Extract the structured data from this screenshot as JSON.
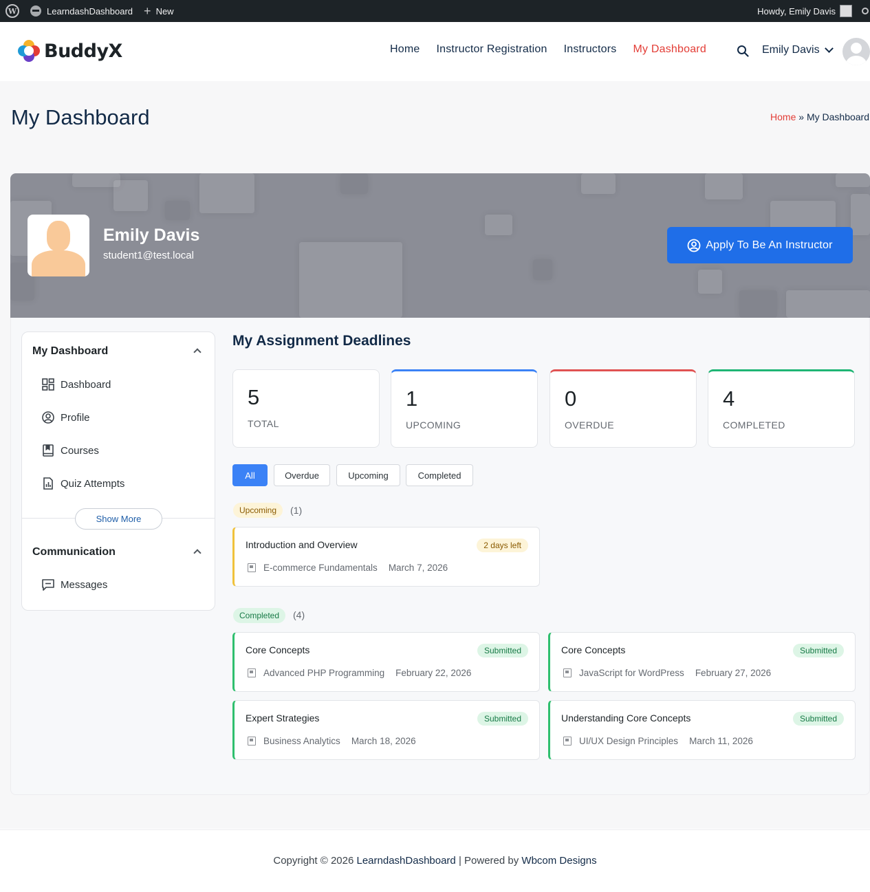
{
  "adminbar": {
    "site_name": "LearndashDashboard",
    "new_label": "New",
    "howdy": "Howdy, Emily Davis"
  },
  "header": {
    "logo_text": "BuddyX",
    "nav": [
      "Home",
      "Instructor Registration",
      "Instructors",
      "My Dashboard"
    ],
    "active_nav": "My Dashboard",
    "user_name": "Emily Davis"
  },
  "page": {
    "title": "My Dashboard",
    "breadcrumb_home": "Home",
    "breadcrumb_sep": "»",
    "breadcrumb_current": "My Dashboard"
  },
  "profile": {
    "name": "Emily Davis",
    "email": "student1@test.local",
    "apply_button": "Apply To Be An Instructor"
  },
  "sidebar": {
    "section1_title": "My Dashboard",
    "items": [
      {
        "label": "Dashboard",
        "icon": "dashboard-grid-icon"
      },
      {
        "label": "Profile",
        "icon": "user-circle-icon"
      },
      {
        "label": "Courses",
        "icon": "book-icon"
      },
      {
        "label": "Quiz Attempts",
        "icon": "report-chart-icon"
      }
    ],
    "show_more": "Show More",
    "section2_title": "Communication",
    "section2_items": [
      {
        "label": "Messages",
        "icon": "message-icon"
      }
    ]
  },
  "deadlines": {
    "title": "My Assignment Deadlines",
    "stats": [
      {
        "value": "5",
        "label": "TOTAL"
      },
      {
        "value": "1",
        "label": "UPCOMING",
        "color": "#3b82f6"
      },
      {
        "value": "0",
        "label": "OVERDUE",
        "color": "#e05252"
      },
      {
        "value": "4",
        "label": "COMPLETED",
        "color": "#1fb574"
      }
    ],
    "filters": [
      "All",
      "Overdue",
      "Upcoming",
      "Completed"
    ],
    "active_filter": "All",
    "upcoming_group": {
      "badge": "Upcoming",
      "count": "(1)",
      "items": [
        {
          "title": "Introduction and Overview",
          "badge": "2 days left",
          "course": "E-commerce Fundamentals",
          "date": "March 7, 2026"
        }
      ]
    },
    "completed_group": {
      "badge": "Completed",
      "count": "(4)",
      "items": [
        {
          "title": "Core Concepts",
          "badge": "Submitted",
          "course": "Advanced PHP Programming",
          "date": "February 22, 2026"
        },
        {
          "title": "Core Concepts",
          "badge": "Submitted",
          "course": "JavaScript for WordPress",
          "date": "February 27, 2026"
        },
        {
          "title": "Expert Strategies",
          "badge": "Submitted",
          "course": "Business Analytics",
          "date": "March 18, 2026"
        },
        {
          "title": "Understanding Core Concepts",
          "badge": "Submitted",
          "course": "UI/UX Design Principles",
          "date": "March 11, 2026"
        }
      ]
    }
  },
  "footer": {
    "prefix": "Copyright © 2026",
    "site": "LearndashDashboard",
    "middle": "| Powered by",
    "company": "Wbcom Designs"
  },
  "colors": {
    "brand_red": "#e33d36",
    "primary_blue": "#1f6ee8",
    "navy": "#122a47"
  }
}
